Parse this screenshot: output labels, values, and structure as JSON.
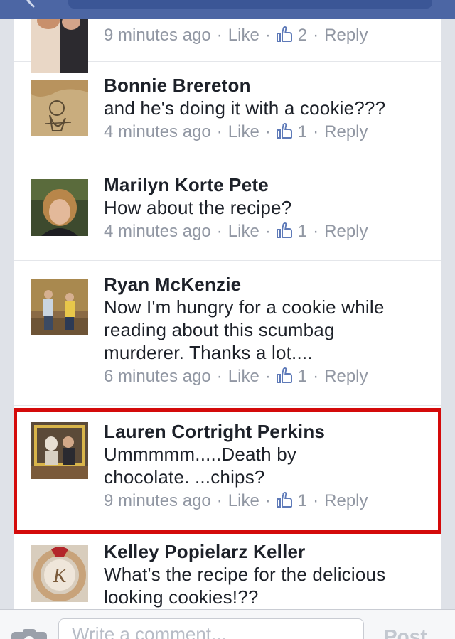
{
  "comments": [
    {
      "author": "",
      "text": "",
      "time": "9 minutes ago",
      "like_label": "Like",
      "likes": "2",
      "reply_label": "Reply"
    },
    {
      "author": "Bonnie Brereton",
      "text": "and he's doing it with a cookie???",
      "time": "4 minutes ago",
      "like_label": "Like",
      "likes": "1",
      "reply_label": "Reply"
    },
    {
      "author": "Marilyn Korte Pete",
      "text": "How about the recipe?",
      "time": "4 minutes ago",
      "like_label": "Like",
      "likes": "1",
      "reply_label": "Reply"
    },
    {
      "author": "Ryan McKenzie",
      "text": "Now I'm hungry for a cookie while\nreading about this scumbag\nmurderer.  Thanks a lot....",
      "time": "6 minutes ago",
      "like_label": "Like",
      "likes": "1",
      "reply_label": "Reply"
    },
    {
      "author": "Lauren Cortright Perkins",
      "text": "Ummmmm.....Death by\nchocolate. ...chips?",
      "time": "9 minutes ago",
      "like_label": "Like",
      "likes": "1",
      "reply_label": "Reply"
    },
    {
      "author": "Kelley Popielarz Keller",
      "text": "What's the recipe for the delicious\nlooking cookies!??",
      "time": "",
      "like_label": "",
      "likes": "",
      "reply_label": ""
    }
  ],
  "composer": {
    "placeholder": "Write a comment...",
    "post_label": "Post"
  },
  "colors": {
    "highlight": "#d40a0a",
    "brand_bar": "#4c66a4",
    "meta_text": "#9197a3",
    "like_icon": "#5e7ab8"
  },
  "icons": [
    "back-icon",
    "like-thumb-icon",
    "camera-icon"
  ]
}
